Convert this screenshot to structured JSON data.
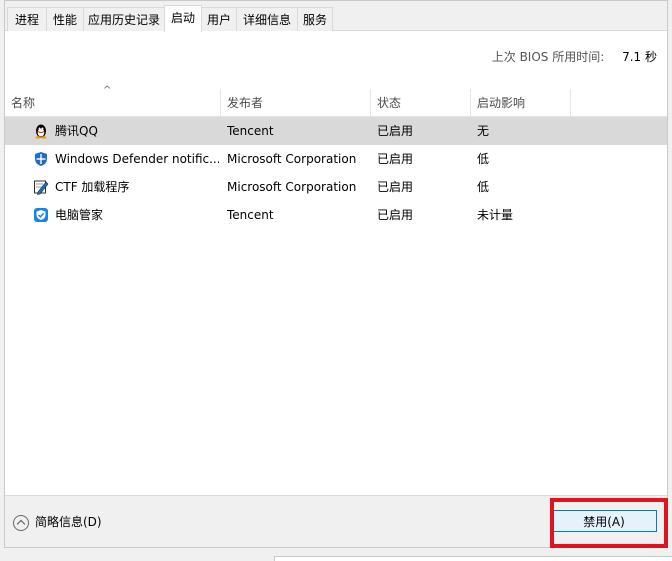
{
  "tabs": [
    {
      "label": "进程",
      "active": false
    },
    {
      "label": "性能",
      "active": false
    },
    {
      "label": "应用历史记录",
      "active": false
    },
    {
      "label": "启动",
      "active": true
    },
    {
      "label": "用户",
      "active": false
    },
    {
      "label": "详细信息",
      "active": false
    },
    {
      "label": "服务",
      "active": false
    }
  ],
  "bios": {
    "label": "上次 BIOS 所用时间:",
    "value": "7.1 秒"
  },
  "columns": {
    "name": "名称",
    "publisher": "发布者",
    "status": "状态",
    "impact": "启动影响"
  },
  "rows": [
    {
      "name": "腾讯QQ",
      "publisher": "Tencent",
      "status": "已启用",
      "impact": "无",
      "icon": "qq-penguin-icon",
      "selected": true
    },
    {
      "name": "Windows Defender notific...",
      "publisher": "Microsoft Corporation",
      "status": "已启用",
      "impact": "低",
      "icon": "windows-defender-shield-icon",
      "selected": false
    },
    {
      "name": "CTF 加载程序",
      "publisher": "Microsoft Corporation",
      "status": "已启用",
      "impact": "低",
      "icon": "ctf-loader-pen-icon",
      "selected": false
    },
    {
      "name": "电脑管家",
      "publisher": "Tencent",
      "status": "已启用",
      "impact": "未计量",
      "icon": "pc-manager-shield-icon",
      "selected": false
    }
  ],
  "footer": {
    "toggle_label": "简略信息(D)",
    "disable_button": "禁用(A)"
  },
  "colors": {
    "highlight": "#e0141d",
    "selection": "#d9d9d9",
    "button_border": "#0078d7"
  }
}
